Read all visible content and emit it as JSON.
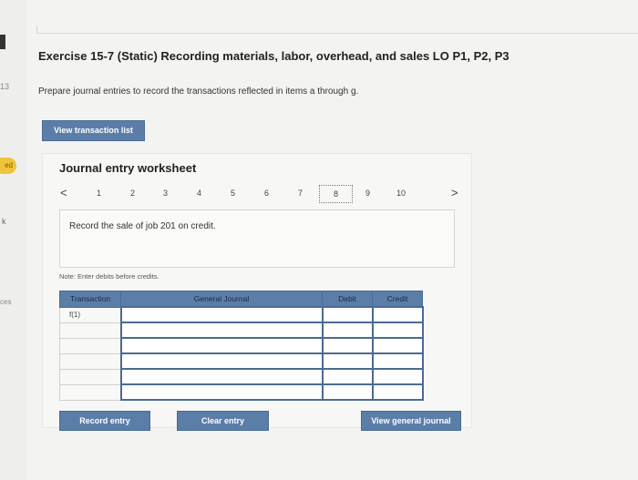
{
  "sidebar": {
    "num": "13",
    "badge": "ed",
    "k": "k",
    "ces": "ces"
  },
  "header": {
    "title": "Exercise 15-7 (Static) Recording materials, labor, overhead, and sales LO P1, P2, P3",
    "instructions": "Prepare journal entries to record the transactions reflected in items a through g."
  },
  "buttons": {
    "view_transaction_list": "View transaction list",
    "record_entry": "Record entry",
    "clear_entry": "Clear entry",
    "view_general_journal": "View general journal"
  },
  "worksheet": {
    "title": "Journal entry worksheet",
    "prev": "<",
    "next": ">",
    "pages": [
      "1",
      "2",
      "3",
      "4",
      "5",
      "6",
      "7",
      "8",
      "9",
      "10"
    ],
    "current_page": "8",
    "description": "Record the sale of job 201 on credit.",
    "note": "Note: Enter debits before credits."
  },
  "journal": {
    "headers": {
      "transaction": "Transaction",
      "general_journal": "General Journal",
      "debit": "Debit",
      "credit": "Credit"
    },
    "rows": [
      {
        "transaction": "f(1)"
      },
      {
        "transaction": ""
      },
      {
        "transaction": ""
      },
      {
        "transaction": ""
      },
      {
        "transaction": ""
      },
      {
        "transaction": ""
      }
    ]
  },
  "colors": {
    "accent": "#5b7ea8",
    "badge": "#f0c43a"
  }
}
